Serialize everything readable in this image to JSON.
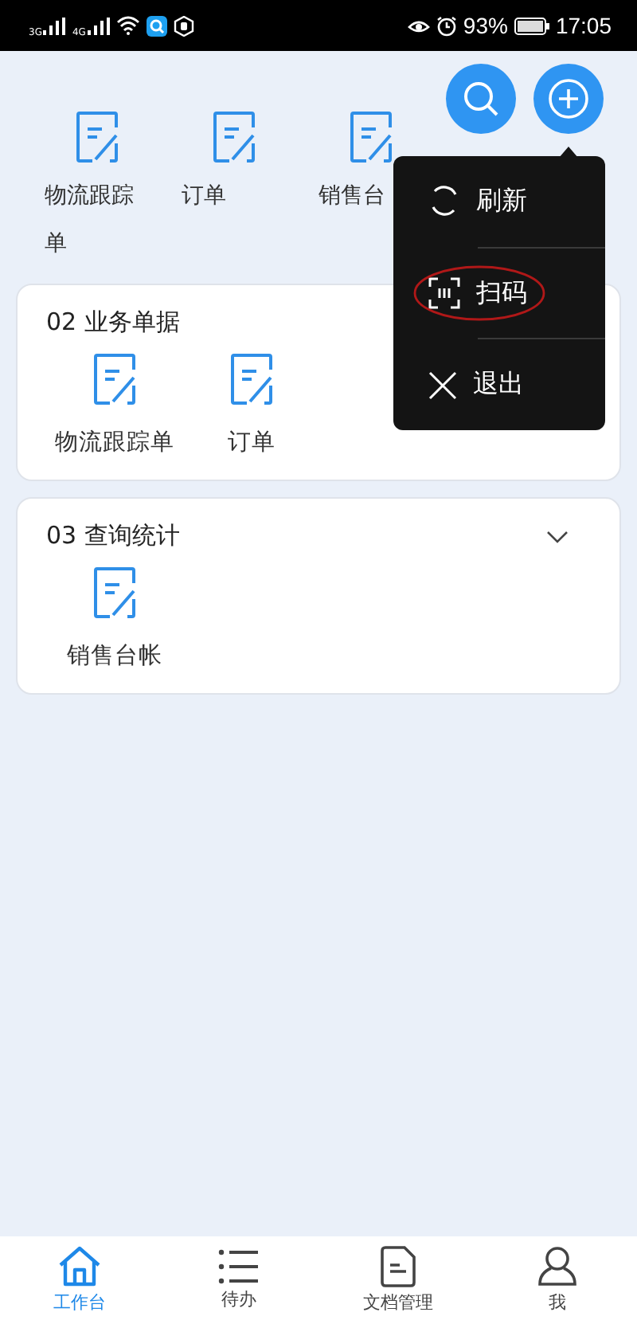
{
  "status_bar": {
    "signal_labels": [
      "3G",
      "4G"
    ],
    "battery": "93%",
    "time": "17:05"
  },
  "top_actions": [
    {
      "kind": "search"
    },
    {
      "kind": "add"
    }
  ],
  "top_section": {
    "items": [
      {
        "label": "物流跟踪单"
      },
      {
        "label": "订单"
      },
      {
        "label": "销售台"
      }
    ]
  },
  "sections": [
    {
      "title": "02 业务单据",
      "chevron": false,
      "items": [
        {
          "label": "物流跟踪单"
        },
        {
          "label": "订单"
        }
      ]
    },
    {
      "title": "03 查询统计",
      "chevron": true,
      "items": [
        {
          "label": "销售台帐"
        }
      ]
    }
  ],
  "popup_menu": {
    "items": [
      {
        "kind": "refresh",
        "label": "刷新",
        "circled": false
      },
      {
        "kind": "scan",
        "label": "扫码",
        "circled": true
      },
      {
        "kind": "exit",
        "label": "退出",
        "circled": false
      }
    ]
  },
  "tab_bar": [
    {
      "kind": "home",
      "label": "工作台",
      "selected": true
    },
    {
      "kind": "list",
      "label": "待办",
      "selected": false
    },
    {
      "kind": "document",
      "label": "文档管理",
      "selected": false
    },
    {
      "kind": "person",
      "label": "我",
      "selected": false
    }
  ]
}
